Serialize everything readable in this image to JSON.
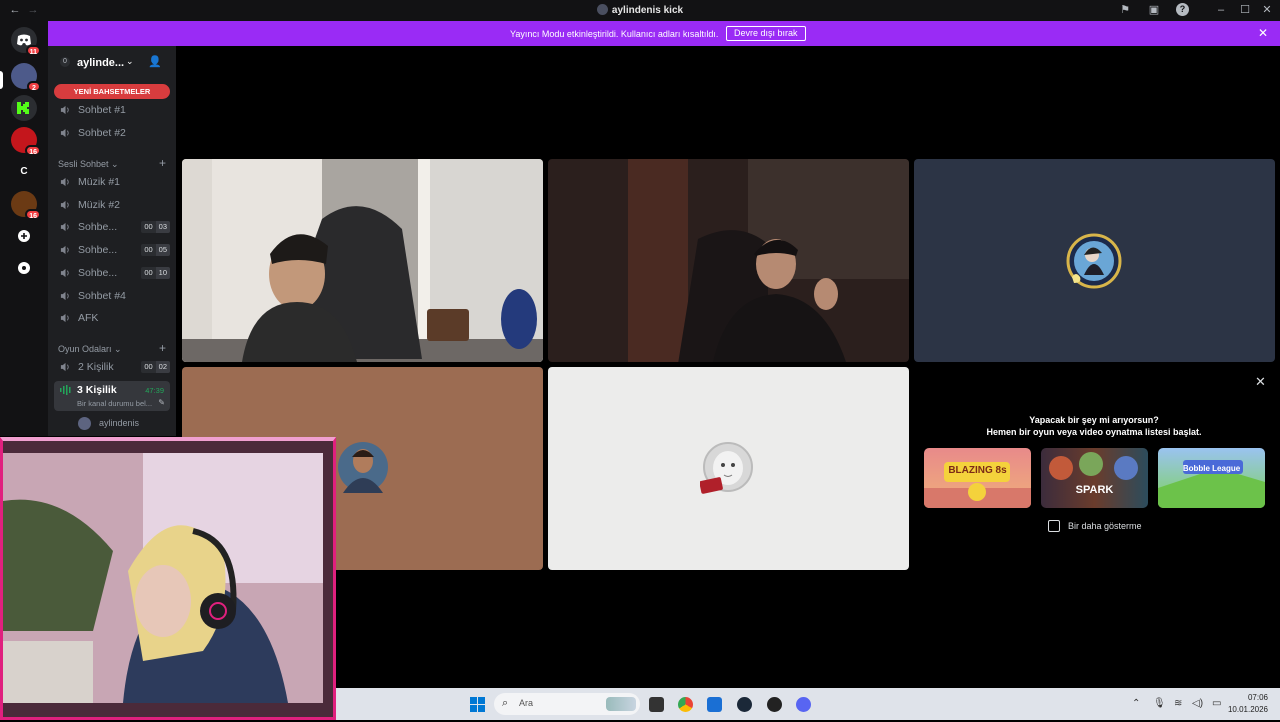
{
  "window": {
    "title": "aylindenis kick"
  },
  "banner": {
    "text": "Yayıncı Modu etkinleştirildi. Kullanıcı adları kısaltıldı.",
    "button_label": "Devre dışı bırak"
  },
  "rail": {
    "badges": [
      "11",
      "2",
      "16",
      "16"
    ],
    "letter_server": "C"
  },
  "server": {
    "name": "aylinde...",
    "boost_count": "0"
  },
  "sidebar": {
    "new_mentions": "YENİ BAHSETMELER",
    "text_channels": [
      {
        "label": "Sohbet #1"
      },
      {
        "label": "Sohbet #2"
      }
    ],
    "voice_category": "Sesli Sohbet",
    "voice_channels": [
      {
        "label": "Müzik #1",
        "count": null
      },
      {
        "label": "Müzik #2",
        "count": null
      },
      {
        "label": "Sohbe...",
        "count": [
          "00",
          "03"
        ]
      },
      {
        "label": "Sohbe...",
        "count": [
          "00",
          "05"
        ]
      },
      {
        "label": "Sohbe...",
        "count": [
          "00",
          "10"
        ]
      },
      {
        "label": "Sohbet #4",
        "count": null
      },
      {
        "label": "AFK",
        "count": null
      }
    ],
    "game_category": "Oyun Odaları",
    "game_channels": [
      {
        "label": "2 Kişilik",
        "count": [
          "00",
          "02"
        ]
      }
    ],
    "active_channel": {
      "label": "3 Kişilik",
      "timer": "47:39",
      "status": "Bir kanal durumu bel..."
    },
    "member": "aylindenis"
  },
  "promo": {
    "question": "Yapacak bir şey mi arıyorsun?",
    "subtitle": "Hemen bir oyun veya video oynatma listesi başlat.",
    "games": [
      "BLAZING 8s",
      "SPARK",
      "Bobble League"
    ],
    "checkbox_label": "Bir daha gösterme"
  },
  "taskbar": {
    "search_placeholder": "Ara",
    "time": "07:06",
    "date": "10.01.2026"
  },
  "colors": {
    "banner": "#9a2bf5",
    "new_mentions": "#d83c3e",
    "voice_active": "#23a55a",
    "facecam_frame": "#e0207e"
  }
}
